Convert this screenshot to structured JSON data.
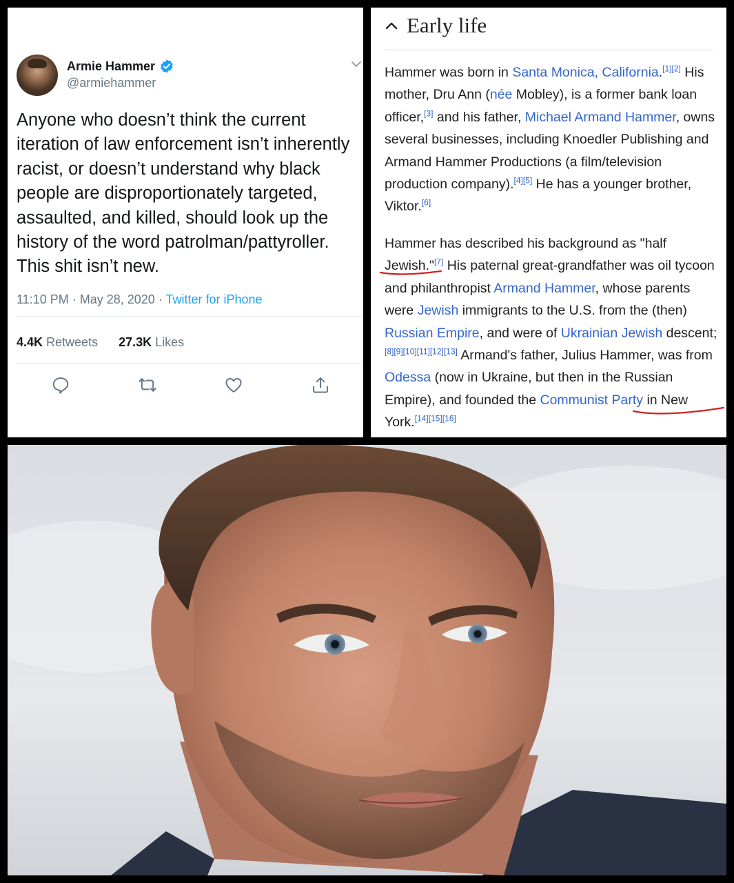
{
  "tweet": {
    "name": "Armie Hammer",
    "handle": "@armiehammer",
    "text": "Anyone who doesn’t think the current iteration of law enforcement isn’t inherently racist, or doesn’t understand why black people are disproportionately targeted, assaulted, and killed, should look up the history of the word patrolman/pattyroller. This shit isn’t new.",
    "time": "11:10 PM · May 28, 2020 · ",
    "source": "Twitter for iPhone",
    "retweets_count": "4.4K",
    "retweets_label": " Retweets",
    "likes_count": "27.3K",
    "likes_label": " Likes"
  },
  "wiki": {
    "section_title": "Early life",
    "p1": {
      "s1": "Hammer was born in ",
      "l1": "Santa Monica, California",
      "s2": ".",
      "r1": "[1][2]",
      "s3": " His mother, Dru Ann (",
      "l2": "née",
      "s4": " Mobley), is a former bank loan officer,",
      "r2": "[3]",
      "s5": " and his father, ",
      "l3": "Michael Armand Hammer",
      "s6": ", owns several businesses, including Knoedler Publishing and Armand Hammer Productions (a film/television production company).",
      "r3": "[4][5]",
      "s7": " He has a younger brother, Viktor.",
      "r4": "[6]"
    },
    "p2": {
      "s1": "Hammer has described his background as \"half ",
      "s2": "Jewish.\"",
      "r1": "[7]",
      "s3": " His paternal great-grandfather was oil tycoon and philanthropist ",
      "l1": "Armand Hammer",
      "s4": ", whose parents were ",
      "l2": "Jewish",
      "s5": " immigrants to the U.S. from the (then) ",
      "l3": "Russian Empire",
      "s6": ", and were of ",
      "l4": "Ukrainian Jewish",
      "s7": " descent;",
      "r2": "[8][9][10][11][12][13]",
      "s8": " Armand's father, Julius Hammer, was from ",
      "l5": "Odessa",
      "s9": " (now in Ukraine, but then in the Russian Empire), and founded the ",
      "l6": "Communist Party",
      "s10": " in New York.",
      "r3": "[14][15][16]"
    }
  },
  "colors": {
    "twitter_blue": "#1da1f2",
    "wiki_link": "#3366cc",
    "annotation_red": "#d61f1f"
  }
}
